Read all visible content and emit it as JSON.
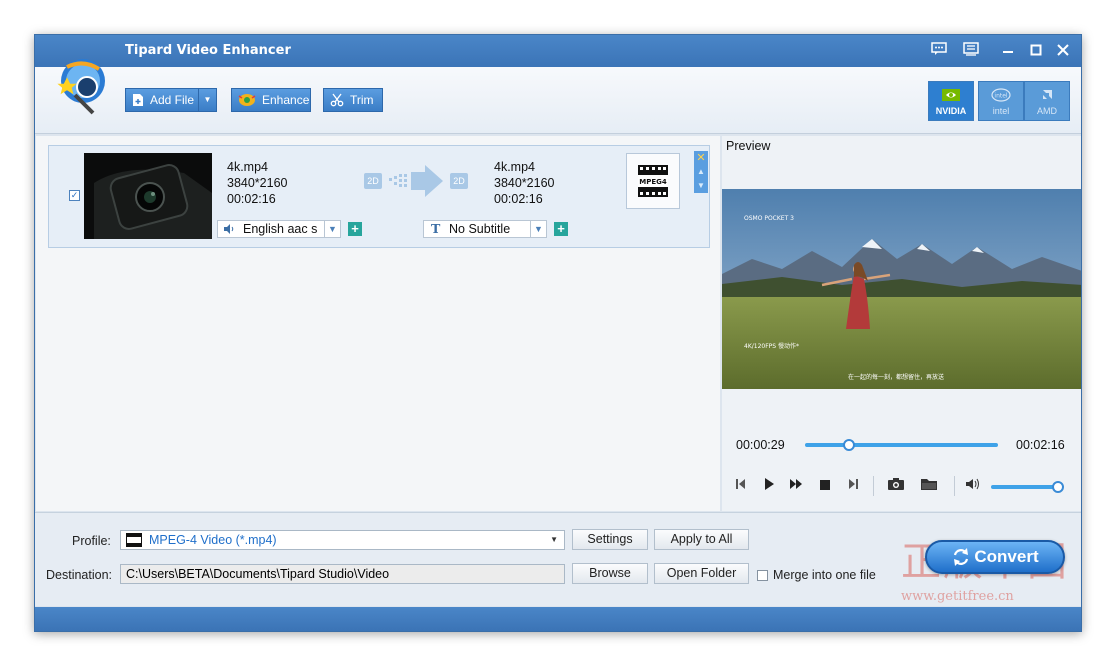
{
  "window": {
    "title": "Tipard Video Enhancer"
  },
  "toolbar": {
    "add_file": "Add File",
    "enhance": "Enhance",
    "trim": "Trim"
  },
  "gpu": [
    {
      "label": "NVIDIA",
      "active": true
    },
    {
      "label": "intel",
      "active": false
    },
    {
      "label": "AMD",
      "active": false
    }
  ],
  "file_item": {
    "checked": true,
    "source": {
      "name": "4k.mp4",
      "resolution": "3840*2160",
      "duration": "00:02:16"
    },
    "output": {
      "name": "4k.mp4",
      "resolution": "3840*2160",
      "duration": "00:02:16"
    },
    "badge_2d": "2D",
    "audio_track": "English aac s",
    "subtitle": "No Subtitle",
    "format_icon": "MPEG4"
  },
  "preview": {
    "label": "Preview",
    "video_brand": "OSMO POCKET 3",
    "video_caption_left": "4K/120FPS 慢动作*",
    "video_caption_center": "在一起的每一刻，都想留住，再放送",
    "current_time": "00:00:29",
    "total_time": "00:02:16",
    "progress": 0.23,
    "volume": 0.95
  },
  "bottom": {
    "profile_label": "Profile:",
    "profile_value": "MPEG-4 Video (*.mp4)",
    "settings": "Settings",
    "apply_to_all": "Apply to All",
    "destination_label": "Destination:",
    "destination_value": "C:\\Users\\BETA\\Documents\\Tipard Studio\\Video",
    "browse": "Browse",
    "open_folder": "Open Folder",
    "merge_label": "Merge into one file",
    "convert": "Convert"
  },
  "watermark": {
    "text_cn": "正版中国",
    "text_url": "www.getitfree.cn"
  },
  "colors": {
    "accent": "#3a7dc6",
    "titlebar": "#3b74b7",
    "convert": "#1f6fca",
    "plus": "#27a59c"
  }
}
